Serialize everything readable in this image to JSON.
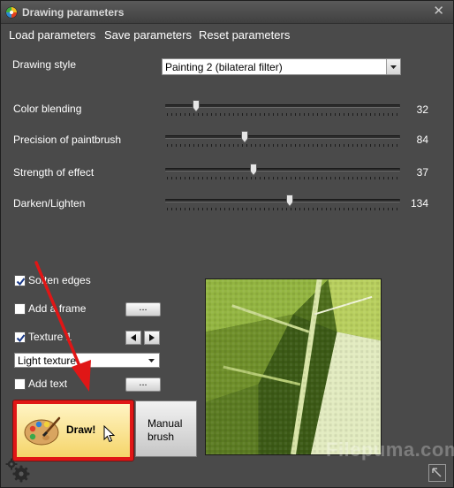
{
  "window": {
    "title": "Drawing parameters",
    "close_glyph": "✕"
  },
  "menu": {
    "load": "Load parameters",
    "save": "Save parameters",
    "reset": "Reset parameters"
  },
  "drawing_style": {
    "label": "Drawing style",
    "value": "Painting 2 (bilateral filter)"
  },
  "sliders": [
    {
      "label": "Color blending",
      "value": "32",
      "fraction": 0.13
    },
    {
      "label": "Precision of paintbrush",
      "value": "84",
      "fraction": 0.34
    },
    {
      "label": "Strength of effect",
      "value": "37",
      "fraction": 0.375
    },
    {
      "label": "Darken/Lighten",
      "value": "134",
      "fraction": 0.53
    }
  ],
  "options": {
    "soften_edges": {
      "label": "Soften edges",
      "checked": true
    },
    "add_frame": {
      "label": "Add a frame",
      "checked": false,
      "button": "..."
    },
    "texture": {
      "label": "Texture 1",
      "checked": true
    },
    "texture_select": {
      "value": "Light texture"
    },
    "add_text": {
      "label": "Add text",
      "checked": false,
      "button": "..."
    }
  },
  "buttons": {
    "draw": "Draw!",
    "manual_line1": "Manual",
    "manual_line2": "brush"
  },
  "watermark": "Filepuma.com",
  "icons": {
    "app": "app-logo-icon",
    "close": "close-icon",
    "dropdown": "chevron-down-icon",
    "prev": "arrow-left-icon",
    "next": "arrow-right-icon",
    "palette": "paint-palette-icon",
    "cursor": "mouse-cursor-icon",
    "settings": "gear-icon",
    "expand": "expand-icon"
  },
  "colors": {
    "highlight": "#e01616",
    "window_bg": "#4a4a4a",
    "draw_button": "#f5d56a"
  }
}
